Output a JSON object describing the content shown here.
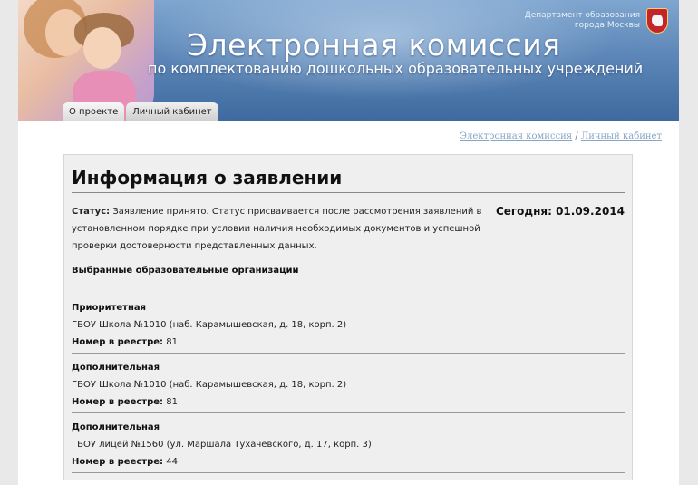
{
  "banner": {
    "title": "Электронная комиссия",
    "subtitle": "по комплектованию дошкольных образовательных учреждений",
    "department_line1": "Департамент образования",
    "department_line2": "города Москвы"
  },
  "tabs": [
    {
      "label": "О проекте"
    },
    {
      "label": "Личный кабинет"
    }
  ],
  "breadcrumb": {
    "home": "Электронная комиссия",
    "separator": "/",
    "current": "Личный кабинет"
  },
  "info": {
    "title": "Информация о заявлении",
    "status_label": "Статус:",
    "status_text": "Заявление принято. Статус присваивается после рассмотрения заявлений в установленном порядке при условии наличия необходимых документов и успешной проверки достоверности представленных данных.",
    "today_label": "Сегодня:",
    "today_value": "01.09.2014",
    "orgs_title": "Выбранные образовательные организации",
    "registry_label": "Номер в реестре:",
    "orgs": [
      {
        "kind": "Приоритетная",
        "name": "ГБОУ Школа №1010 (наб. Карамышевская, д. 18, корп. 2)",
        "registry": "81"
      },
      {
        "kind": "Дополнительная",
        "name": "ГБОУ Школа №1010 (наб. Карамышевская, д. 18, корп. 2)",
        "registry": "81"
      },
      {
        "kind": "Дополнительная",
        "name": "ГБОУ лицей №1560 (ул. Маршала Тухачевского, д. 17, корп. 3)",
        "registry": "44"
      }
    ]
  },
  "colors": {
    "banner_blue": "#5d87b8",
    "link": "#86a6c4",
    "panel_bg": "#efefef"
  }
}
